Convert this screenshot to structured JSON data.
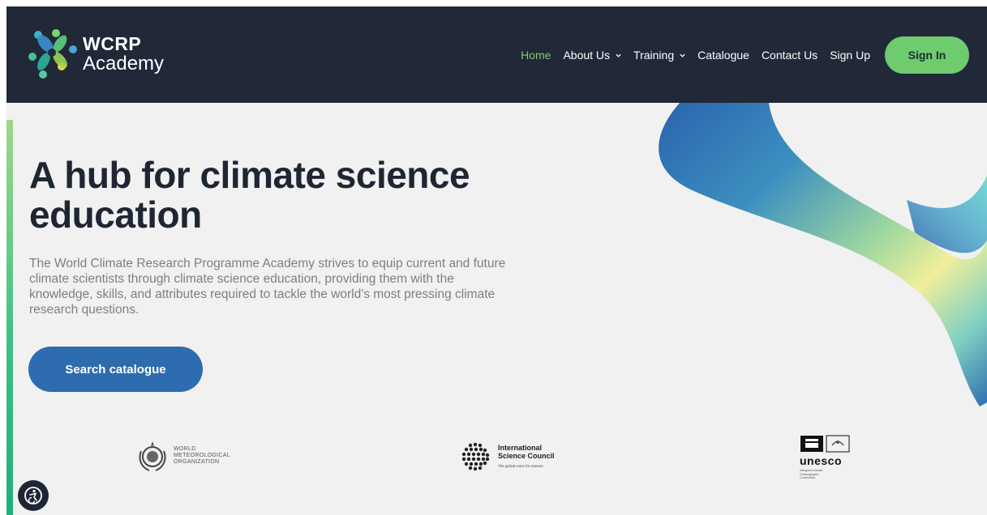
{
  "header": {
    "logo": {
      "line1": "WCRP",
      "line2": "Academy",
      "icon": "wcrp-logo-icon"
    },
    "nav": [
      {
        "label": "Home",
        "active": true,
        "dropdown": false
      },
      {
        "label": "About Us",
        "active": false,
        "dropdown": true
      },
      {
        "label": "Training",
        "active": false,
        "dropdown": true
      },
      {
        "label": "Catalogue",
        "active": false,
        "dropdown": false
      },
      {
        "label": "Contact Us",
        "active": false,
        "dropdown": false
      },
      {
        "label": "Sign Up",
        "active": false,
        "dropdown": false
      }
    ],
    "signin_label": "Sign In"
  },
  "hero": {
    "title_line1": "A hub for climate science",
    "title_line2": "education",
    "description": "The World Climate Research Programme Academy strives to equip current and future climate scientists through climate science education, providing them with the knowledge, skills, and attributes required to tackle the world's most pressing climate research questions.",
    "cta_label": "Search catalogue"
  },
  "partners": {
    "wmo": {
      "line1": "WORLD",
      "line2": "METEOROLOGICAL",
      "line3": "ORGANIZATION"
    },
    "isc": {
      "line1": "International",
      "line2": "Science Council",
      "tagline": "The global voice for science"
    },
    "unesco": {
      "name": "unesco",
      "line1": "Intergovernmental",
      "line2": "Oceanographic",
      "line3": "Commission"
    }
  },
  "accessibility": {
    "icon": "accessibility-icon"
  },
  "colors": {
    "header_bg": "#212838",
    "accent_green": "#6ecb6e",
    "nav_active": "#7ecb73",
    "primary_blue": "#2d6cae",
    "page_bg": "#f1f1f1",
    "title_text": "#1f2633"
  }
}
